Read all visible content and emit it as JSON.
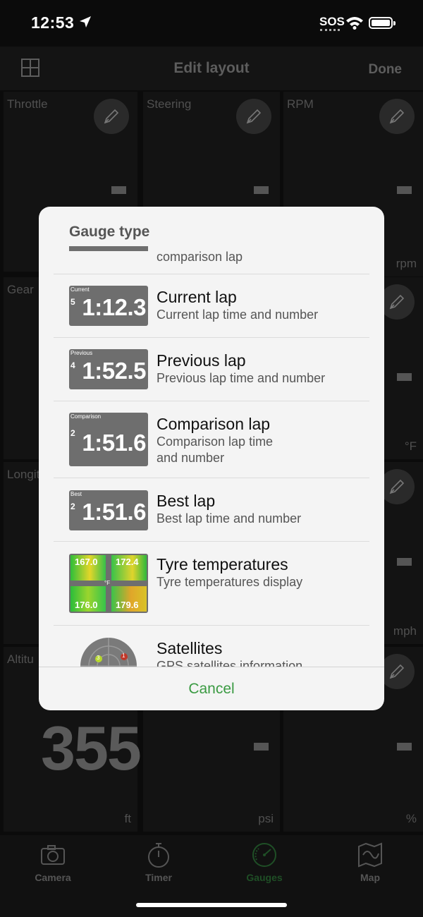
{
  "status_bar": {
    "time": "12:53",
    "sos": "SOS",
    "location_icon": "location-arrow-icon",
    "wifi_icon": "wifi-icon",
    "battery_icon": "battery-icon"
  },
  "nav": {
    "title": "Edit layout",
    "done_label": "Done",
    "grid_icon": "grid-icon"
  },
  "tiles": {
    "throttle": "Throttle",
    "steering": "Steering",
    "rpm": "RPM",
    "rpm_unit": "rpm",
    "gear": "Gear",
    "temp_unit": "°F",
    "longit": "Longit",
    "speed_unit": "mph",
    "altitude": "Altitu",
    "altitude_value": "355",
    "altitude_unit": "ft",
    "pressure_unit": "psi",
    "percent_unit": "%"
  },
  "modal": {
    "title": "Gauge type",
    "cancel_label": "Cancel",
    "partial_item_text": "comparison lap",
    "items": [
      {
        "title": "Current lap",
        "subtitle": "Current lap time and number",
        "thumb_label": "Current",
        "thumb_num": "5",
        "thumb_value": "1:12.3"
      },
      {
        "title": "Previous lap",
        "subtitle": "Previous lap time and number",
        "thumb_label": "Previous",
        "thumb_num": "4",
        "thumb_value": "1:52.5"
      },
      {
        "title": "Comparison lap",
        "subtitle": "Comparison lap time",
        "subtitle2": "and number",
        "thumb_label": "Comparison",
        "thumb_num": "2",
        "thumb_value": "1:51.6"
      },
      {
        "title": "Best lap",
        "subtitle": "Best lap time and number",
        "thumb_label": "Best",
        "thumb_num": "2",
        "thumb_value": "1:51.6"
      },
      {
        "title": "Tyre temperatures",
        "subtitle": "Tyre temperatures display",
        "temps": [
          "167.0",
          "172.4",
          "176.0",
          "179.6"
        ],
        "temp_unit": "°F"
      },
      {
        "title": "Satellites",
        "subtitle": "GPS satellites information",
        "sat_labels": [
          "3",
          "1"
        ]
      }
    ]
  },
  "tabbar": {
    "tabs": [
      {
        "label": "Camera",
        "icon": "camera-icon"
      },
      {
        "label": "Timer",
        "icon": "stopwatch-icon"
      },
      {
        "label": "Gauges",
        "icon": "gauge-icon"
      },
      {
        "label": "Map",
        "icon": "map-icon"
      }
    ]
  },
  "colors": {
    "accent_green": "#3a9a42",
    "gauges_tab_active": "#1f4f26",
    "background": "#0b0b0b",
    "modal_bg": "#f4f4f4"
  }
}
